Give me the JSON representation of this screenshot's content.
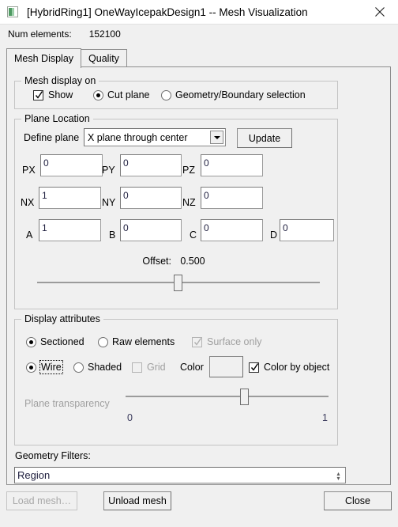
{
  "window": {
    "title": "[HybridRing1] OneWayIcepakDesign1 -- Mesh Visualization",
    "icon": "app-mesh-icon",
    "close_label": "close-icon"
  },
  "status": {
    "num_elements_label": "Num elements:",
    "num_elements_value": "152100"
  },
  "tabs": [
    {
      "label": "Mesh Display",
      "selected": true
    },
    {
      "label": "Quality",
      "selected": false
    }
  ],
  "mesh_display_on": {
    "title": "Mesh display on",
    "show": {
      "label": "Show",
      "checked": true
    },
    "cut_plane": {
      "label": "Cut plane",
      "checked": true
    },
    "geometry_boundary": {
      "label": "Geometry/Boundary selection",
      "checked": false
    }
  },
  "plane_location": {
    "title": "Plane Location",
    "define_plane_label": "Define plane",
    "define_plane_value": "X plane through center",
    "update_label": "Update",
    "fields": [
      {
        "label": "PX",
        "value": "0"
      },
      {
        "label": "PY",
        "value": "0"
      },
      {
        "label": "PZ",
        "value": "0"
      },
      {
        "label": "NX",
        "value": "1"
      },
      {
        "label": "NY",
        "value": "0"
      },
      {
        "label": "NZ",
        "value": "0"
      },
      {
        "label": "A",
        "value": "1"
      },
      {
        "label": "B",
        "value": "0"
      },
      {
        "label": "C",
        "value": "0"
      },
      {
        "label": "D",
        "value": "0"
      }
    ],
    "offset_label": "Offset:",
    "offset_value": "0.500",
    "offset_slider_percent": 50
  },
  "display_attributes": {
    "title": "Display attributes",
    "sectioned": {
      "label": "Sectioned",
      "checked": true
    },
    "raw_elements": {
      "label": "Raw elements",
      "checked": false
    },
    "surface_only": {
      "label": "Surface only",
      "checked": true,
      "disabled": true
    },
    "wire": {
      "label": "Wire",
      "checked": true,
      "focused": true
    },
    "shaded": {
      "label": "Shaded",
      "checked": false
    },
    "grid": {
      "label": "Grid",
      "checked": false,
      "disabled": true
    },
    "color_label": "Color",
    "color_value": "#f0f0f0",
    "color_by_object": {
      "label": "Color by object",
      "checked": true
    },
    "plane_transparency_label": "Plane transparency",
    "plane_transparency_disabled": true,
    "transparency_min": "0",
    "transparency_max": "1",
    "transparency_slider_percent": 57
  },
  "geometry_filters": {
    "label": "Geometry Filters:",
    "items": [
      "Region"
    ]
  },
  "footer": {
    "load_mesh": {
      "label": "Load mesh…",
      "disabled": true
    },
    "unload_mesh": {
      "label": "Unload mesh",
      "disabled": false
    },
    "close": {
      "label": "Close",
      "disabled": false
    }
  }
}
